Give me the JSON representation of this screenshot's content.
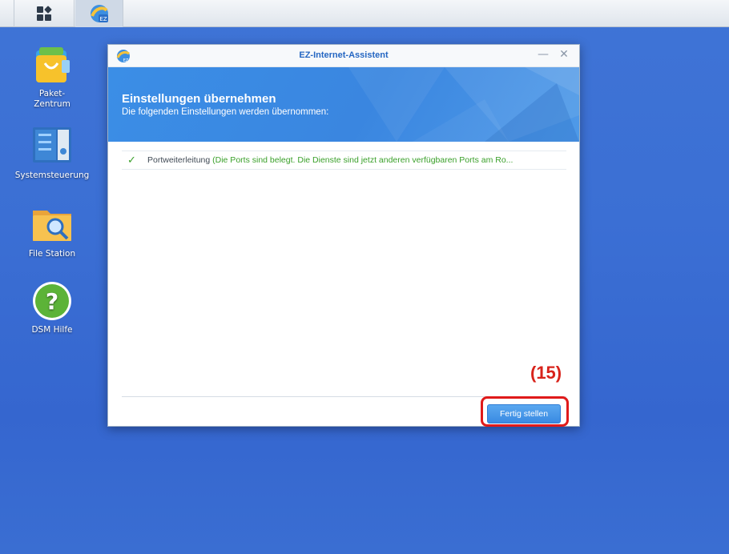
{
  "taskbar": {
    "main_menu_icon": "grid-icon",
    "running_app_icon": "ez-internet-icon",
    "running_app_badge": "EZ"
  },
  "desktop": {
    "icons": [
      {
        "label": "Paket-\nZentrum",
        "icon": "package-center-icon"
      },
      {
        "label": "Systemsteuerung",
        "icon": "control-panel-icon"
      },
      {
        "label": "File Station",
        "icon": "file-station-icon"
      },
      {
        "label": "DSM Hilfe",
        "icon": "help-icon"
      }
    ]
  },
  "window": {
    "title": "EZ-Internet-Assistent",
    "app_badge": "EZ",
    "minimize_symbol": "—",
    "close_symbol": "✕",
    "banner": {
      "heading": "Einstellungen übernehmen",
      "subheading": "Die folgenden Einstellungen werden übernommen:"
    },
    "results": [
      {
        "status_icon": "check-icon",
        "label": "Portweiterleitung",
        "detail": "(Die Ports sind belegt. Die Dienste sind jetzt anderen verfügbaren Ports am Ro..."
      }
    ],
    "finish_label": "Fertig stellen"
  },
  "annotation": {
    "number": "(15)",
    "color": "#e01a1a"
  },
  "colors": {
    "desktop_blue": "#3b6fd4",
    "accent_blue": "#2466c2",
    "success_green": "#3aa02a"
  }
}
